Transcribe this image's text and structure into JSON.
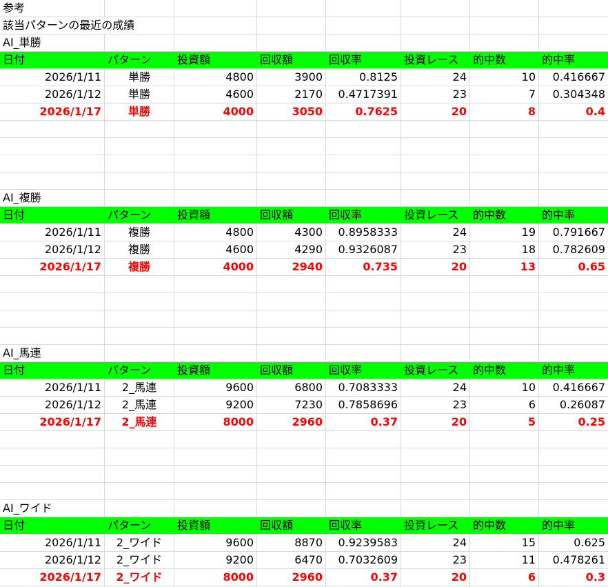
{
  "top_lines": [
    "参考",
    "該当パターンの最近の成績"
  ],
  "headers": [
    "日付",
    "パターン",
    "投資額",
    "回収額",
    "回収率",
    "投資レース",
    "的中数",
    "的中率"
  ],
  "sections": [
    {
      "title": "AI_単勝",
      "rows": [
        [
          "2026/1/11",
          "単勝",
          "4800",
          "3900",
          "0.8125",
          "24",
          "10",
          "0.416667"
        ],
        [
          "2026/1/12",
          "単勝",
          "4600",
          "2170",
          "0.4717391",
          "23",
          "7",
          "0.304348"
        ],
        [
          "2026/1/17",
          "単勝",
          "4000",
          "3050",
          "0.7625",
          "20",
          "8",
          "0.4"
        ]
      ]
    },
    {
      "title": "AI_複勝",
      "rows": [
        [
          "2026/1/11",
          "複勝",
          "4800",
          "4300",
          "0.8958333",
          "24",
          "19",
          "0.791667"
        ],
        [
          "2026/1/12",
          "複勝",
          "4600",
          "4290",
          "0.9326087",
          "23",
          "18",
          "0.782609"
        ],
        [
          "2026/1/17",
          "複勝",
          "4000",
          "2940",
          "0.735",
          "20",
          "13",
          "0.65"
        ]
      ]
    },
    {
      "title": "AI_馬連",
      "rows": [
        [
          "2026/1/11",
          "2_馬連",
          "9600",
          "6800",
          "0.7083333",
          "24",
          "10",
          "0.416667"
        ],
        [
          "2026/1/12",
          "2_馬連",
          "9200",
          "7230",
          "0.7858696",
          "23",
          "6",
          "0.26087"
        ],
        [
          "2026/1/17",
          "2_馬連",
          "8000",
          "2960",
          "0.37",
          "20",
          "5",
          "0.25"
        ]
      ]
    },
    {
      "title": "AI_ワイド",
      "rows": [
        [
          "2026/1/11",
          "2_ワイド",
          "9600",
          "8870",
          "0.9239583",
          "24",
          "15",
          "0.625"
        ],
        [
          "2026/1/12",
          "2_ワイド",
          "9200",
          "6470",
          "0.7032609",
          "23",
          "11",
          "0.478261"
        ],
        [
          "2026/1/17",
          "2_ワイド",
          "8000",
          "2960",
          "0.37",
          "20",
          "6",
          "0.3"
        ]
      ]
    }
  ],
  "colors": {
    "header_bg": "#00ff00",
    "highlight_text": "#ff0000",
    "grid": "#d9d9d9"
  }
}
